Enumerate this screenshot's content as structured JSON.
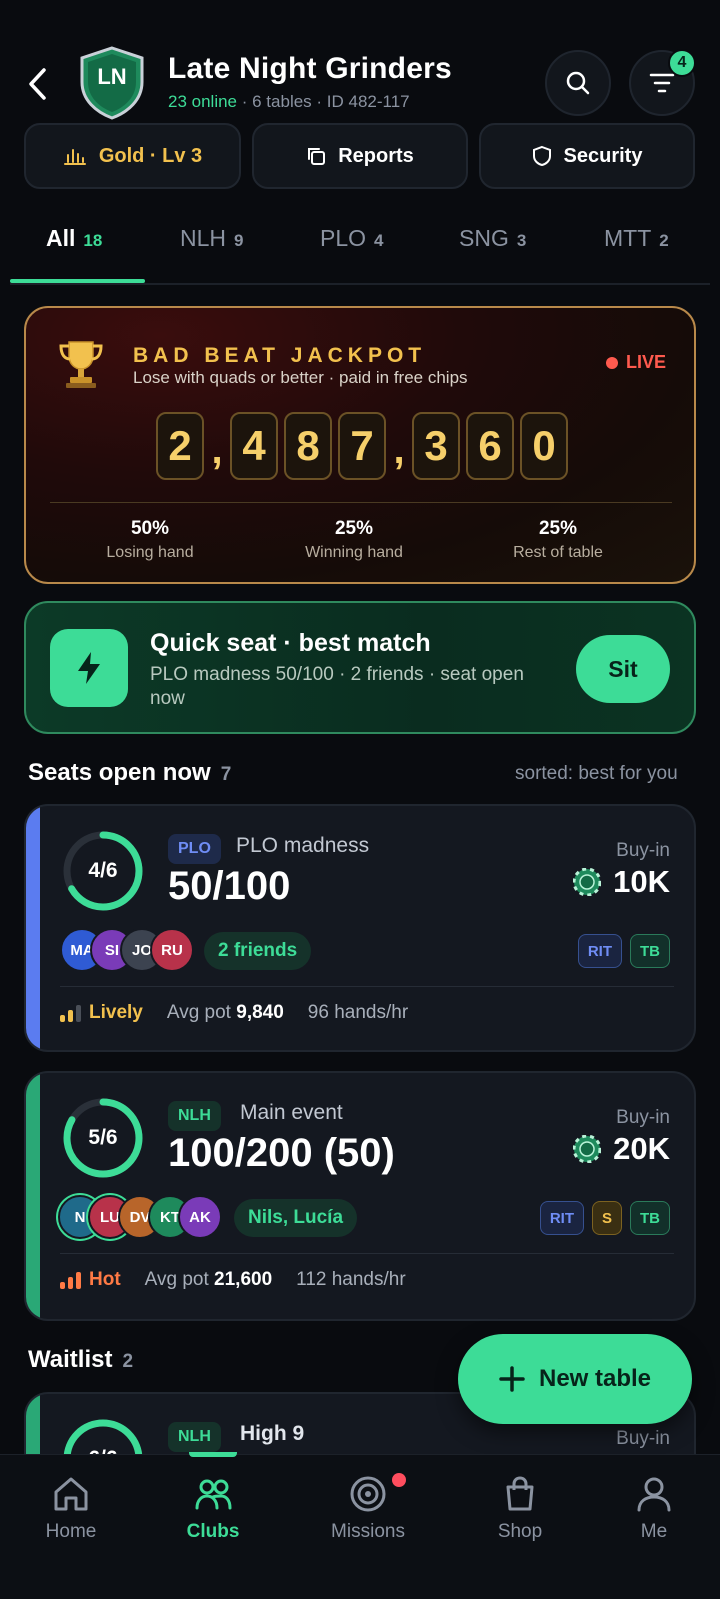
{
  "header": {
    "title": "Late Night Grinders",
    "crest_initials": "LN",
    "online": "23 online",
    "meta": "· 6 tables · ID 482-117",
    "filter_badge": "4"
  },
  "actions": {
    "gold_label": "Gold · Lv 3",
    "reports_label": "Reports",
    "security_label": "Security"
  },
  "tabs": [
    {
      "label": "All",
      "count": "18"
    },
    {
      "label": "NLH",
      "count": "9"
    },
    {
      "label": "PLO",
      "count": "4"
    },
    {
      "label": "SNG",
      "count": "3"
    },
    {
      "label": "MTT",
      "count": "2"
    }
  ],
  "jackpot": {
    "title": "BAD BEAT JACKPOT",
    "subtitle": "Lose with quads or better · paid in free chips",
    "live": "LIVE",
    "digits": [
      "2",
      ",",
      "4",
      "8",
      "7",
      ",",
      "3",
      "6",
      "0"
    ],
    "splits": [
      {
        "pct": "50%",
        "label": "Losing hand"
      },
      {
        "pct": "25%",
        "label": "Winning hand"
      },
      {
        "pct": "25%",
        "label": "Rest of table"
      }
    ]
  },
  "quick_seat": {
    "title": "Quick seat · best match",
    "subtitle": "PLO madness 50/100 · 2 friends · seat open now",
    "button": "Sit"
  },
  "seats_open": {
    "heading": "Seats open now",
    "count": "7",
    "sort": "sorted: best for you"
  },
  "tables": [
    {
      "seats": "4/6",
      "fill": 0.667,
      "game": "PLO",
      "name": "PLO madness",
      "stakes": "50/100",
      "buyin_label": "Buy-in",
      "buyin": "10K",
      "avatars": [
        "MA",
        "SI",
        "JO",
        "RU"
      ],
      "friends": "2 friends",
      "chips": [
        "RIT",
        "TB"
      ],
      "activity": "Lively",
      "avg_pot_label": "Avg pot",
      "avg_pot": "9,840",
      "hands": "96 hands/hr"
    },
    {
      "seats": "5/6",
      "fill": 0.833,
      "game": "NLH",
      "name": "Main event",
      "stakes": "100/200 (50)",
      "buyin_label": "Buy-in",
      "buyin": "20K",
      "avatars": [
        "N",
        "LU",
        "DV",
        "KT",
        "AK"
      ],
      "friends": "Nils, Lucía",
      "chips": [
        "RIT",
        "S",
        "TB"
      ],
      "activity": "Hot",
      "avg_pot_label": "Avg pot",
      "avg_pot": "21,600",
      "hands": "112 hands/hr"
    }
  ],
  "waitlist": {
    "heading": "Waitlist",
    "count": "2",
    "first": {
      "seats": "6/6",
      "game": "NLH",
      "name": "High 9",
      "buyin_label": "Buy-in"
    }
  },
  "fab": {
    "label": "New table"
  },
  "nav": [
    {
      "label": "Home"
    },
    {
      "label": "Clubs"
    },
    {
      "label": "Missions"
    },
    {
      "label": "Shop"
    },
    {
      "label": "Me"
    }
  ],
  "colors": {
    "accent": "#3ddc97",
    "gold": "#f2c14e",
    "live": "#ff5a4e",
    "plo": "#5b7cf0"
  }
}
